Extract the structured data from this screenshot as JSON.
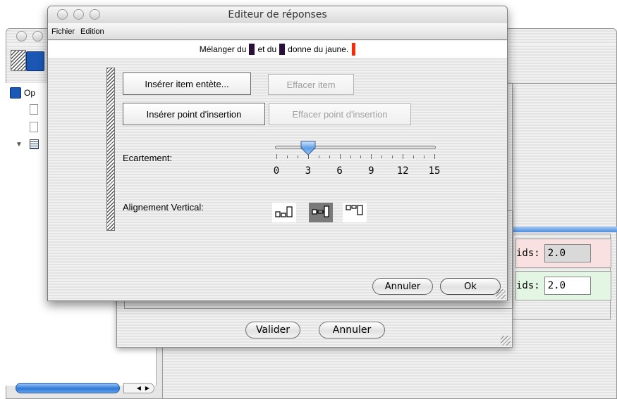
{
  "background_window": {
    "tree_label": "Op",
    "fields": [
      {
        "label": "ids:",
        "value": "2.0"
      },
      {
        "label": "ids:",
        "value": "2.0"
      }
    ],
    "buttons": {
      "validate": "Valider",
      "cancel": "Annuler"
    }
  },
  "dialog": {
    "title": "Editeur de réponses",
    "menu": {
      "file": "Fichier",
      "edit": "Edition"
    },
    "sentence": {
      "part1": "Mélanger du",
      "part2": "et du",
      "part3": "donne du jaune."
    },
    "buttons": {
      "insert_header": "Insérer item entète...",
      "delete_item": "Effacer item",
      "insert_point": "Insérer point d'insertion",
      "delete_point": "Effacer point d'insertion",
      "cancel": "Annuler",
      "ok": "Ok"
    },
    "spacing": {
      "label": "Ecartement:",
      "value": 3,
      "min": 0,
      "max": 15,
      "tick_labels": [
        "0",
        "3",
        "6",
        "9",
        "12",
        "15"
      ]
    },
    "vertical_alignment": {
      "label": "Alignement Vertical:",
      "options": [
        "bottom",
        "middle",
        "top"
      ],
      "selected": "middle"
    }
  }
}
